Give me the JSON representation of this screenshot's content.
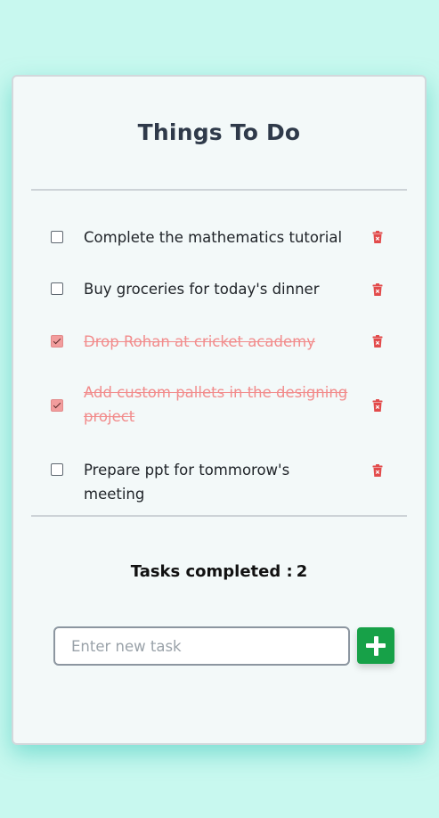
{
  "title": "Things To Do",
  "tasks": [
    {
      "text": "Complete the mathematics tutorial",
      "completed": false
    },
    {
      "text": "Buy groceries for today's dinner",
      "completed": false
    },
    {
      "text": "Drop Rohan at cricket academy",
      "completed": true
    },
    {
      "text": "Add custom pallets in the designing project",
      "completed": true
    },
    {
      "text": "Prepare ppt for tommorow's meeting",
      "completed": false
    }
  ],
  "summary": {
    "label": "Tasks completed :",
    "count": "2"
  },
  "new_task": {
    "placeholder": "Enter new task",
    "value": ""
  },
  "add_button": {
    "icon": "plus-icon"
  },
  "colors": {
    "background": "#c8f8ef",
    "card": "#f3f9f9",
    "completed_text": "#f28c8c",
    "delete_icon": "#e24b4b",
    "add_button": "#17a148"
  }
}
